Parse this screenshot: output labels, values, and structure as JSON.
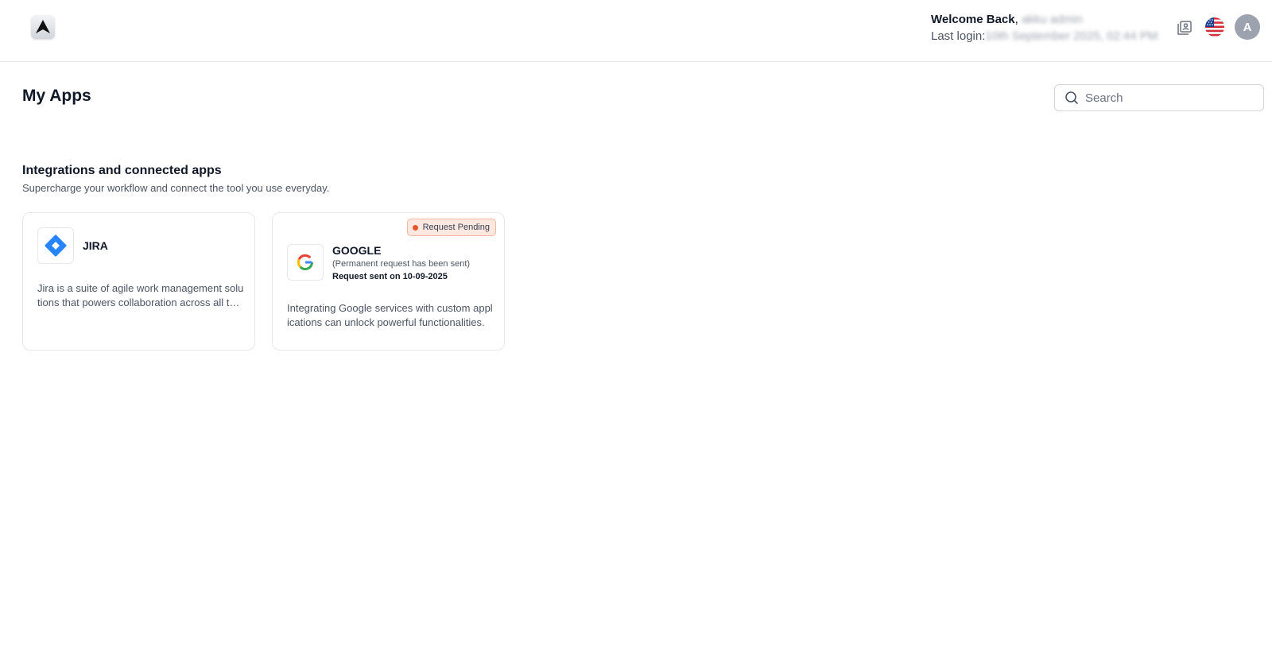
{
  "header": {
    "welcome_label": "Welcome Back",
    "welcome_sep": ",",
    "username": "akku admin",
    "last_login_label": "Last login:",
    "last_login_value": "10th September 2025, 02:44 PM",
    "avatar_initial": "A"
  },
  "page": {
    "title": "My Apps",
    "search_placeholder": "Search"
  },
  "section": {
    "title": "Integrations and connected apps",
    "subtitle": "Supercharge your workflow and connect the tool you use everyday."
  },
  "apps": [
    {
      "name": "JIRA",
      "icon": "jira-icon",
      "description": "Jira is a suite of agile work management solutions that powers collaboration across all teams."
    },
    {
      "name": "GOOGLE",
      "icon": "google-icon",
      "status_badge": "Request Pending",
      "request_note": "(Permanent request has been sent)",
      "request_date": "Request sent on 10-09-2025",
      "description": "Integrating Google services with custom applications can unlock powerful functionalities."
    }
  ],
  "colors": {
    "accent_jira": "#2684ff",
    "badge_bg": "#fde8e1",
    "badge_dot": "#e4572e",
    "avatar_bg": "#9ca3af"
  }
}
